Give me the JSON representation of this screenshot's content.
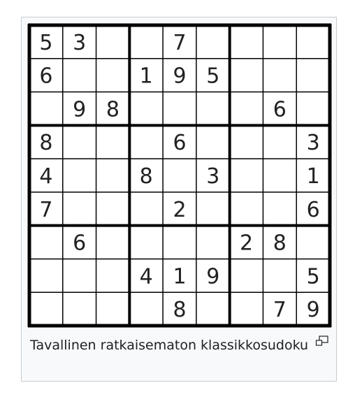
{
  "figure": {
    "caption": "Tavallinen ratkaisematon klassikkosudoku",
    "enlarge_icon": "magnify-clip-icon"
  },
  "sudoku": {
    "grid": [
      [
        "5",
        "3",
        "",
        "",
        "7",
        "",
        "",
        "",
        ""
      ],
      [
        "6",
        "",
        "",
        "1",
        "9",
        "5",
        "",
        "",
        ""
      ],
      [
        "",
        "9",
        "8",
        "",
        "",
        "",
        "",
        "6",
        ""
      ],
      [
        "8",
        "",
        "",
        "",
        "6",
        "",
        "",
        "",
        "3"
      ],
      [
        "4",
        "",
        "",
        "8",
        "",
        "3",
        "",
        "",
        "1"
      ],
      [
        "7",
        "",
        "",
        "",
        "2",
        "",
        "",
        "",
        "6"
      ],
      [
        "",
        "6",
        "",
        "",
        "",
        "",
        "2",
        "8",
        ""
      ],
      [
        "",
        "",
        "",
        "4",
        "1",
        "9",
        "",
        "",
        "5"
      ],
      [
        "",
        "",
        "",
        "",
        "8",
        "",
        "",
        "7",
        "9"
      ]
    ]
  },
  "colors": {
    "border": "#c8ccd1",
    "frame_bg": "#f8f9fa",
    "grid_line": "#000000",
    "text": "#202122"
  }
}
